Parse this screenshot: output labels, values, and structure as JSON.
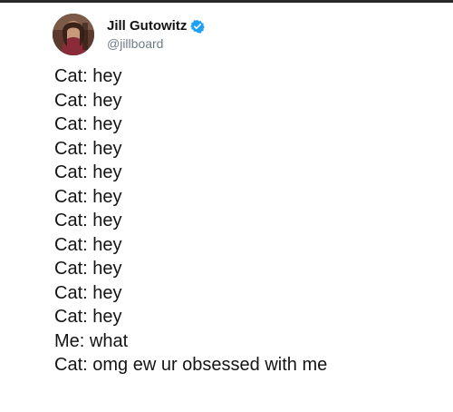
{
  "tweet": {
    "author": {
      "display_name": "Jill Gutowitz",
      "handle": "@jillboard",
      "verified": true,
      "verified_color": "#1da1f2"
    },
    "lines": [
      "Cat: hey",
      "Cat: hey",
      "Cat: hey",
      "Cat: hey",
      "Cat: hey",
      "Cat: hey",
      "Cat: hey",
      "Cat: hey",
      "Cat: hey",
      "Cat: hey",
      "Cat: hey",
      "Me: what",
      "Cat: omg ew ur obsessed with me"
    ]
  }
}
